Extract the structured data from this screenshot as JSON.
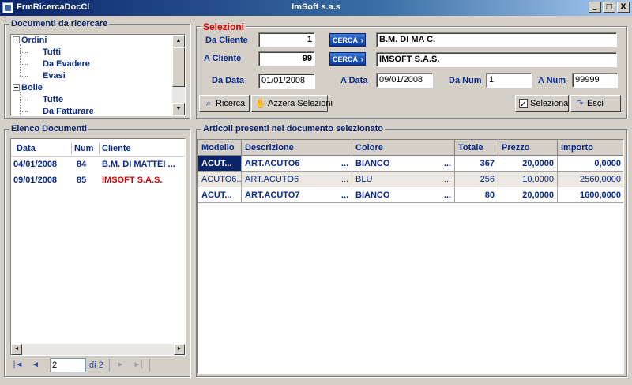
{
  "window": {
    "title": "FrmRicercaDocCl",
    "center_title": "ImSoft s.a.s",
    "min": "_",
    "max": "□",
    "close": "X"
  },
  "tree": {
    "title": "Documenti da ricercare",
    "items": [
      {
        "label": "Ordini",
        "level": 0
      },
      {
        "label": "Tutti",
        "level": 1
      },
      {
        "label": "Da Evadere",
        "level": 1
      },
      {
        "label": "Evasi",
        "level": 1
      },
      {
        "label": "Bolle",
        "level": 0
      },
      {
        "label": "Tutte",
        "level": 1
      },
      {
        "label": "Da Fatturare",
        "level": 1
      }
    ]
  },
  "selezioni": {
    "title": "Selezioni",
    "da_cliente_label": "Da Cliente",
    "da_cliente_value": "1",
    "da_cliente_name": "B.M. DI MA C.",
    "a_cliente_label": "A Cliente",
    "a_cliente_value": "99",
    "a_cliente_name": "IMSOFT S.A.S.",
    "cerca_label": "CERCA",
    "da_data_label": "Da Data",
    "da_data_value": "01/01/2008",
    "a_data_label": "A Data",
    "a_data_value": "09/01/2008",
    "da_num_label": "Da Num",
    "da_num_value": "1",
    "a_num_label": "A Num",
    "a_num_value": "99999"
  },
  "toolbar": {
    "ricerca": "Ricerca",
    "azzera": "Azzera Selezioni",
    "seleziona": "Seleziona",
    "esci": "Esci"
  },
  "elenco": {
    "title": "Elenco Documenti",
    "headers": [
      "Data",
      "Num",
      "Cliente"
    ],
    "rows": [
      {
        "data": "04/01/2008",
        "num": "84",
        "cliente": "B.M. DI MATTEI ...",
        "color": "#0a2a8a"
      },
      {
        "data": "09/01/2008",
        "num": "85",
        "cliente": "IMSOFT S.A.S.",
        "color": "#e00000"
      }
    ]
  },
  "navigator": {
    "position": "2",
    "of_label": "di 2"
  },
  "articoli": {
    "title": "Articoli presenti nel documento selezionato",
    "headers": [
      "Modello",
      "Descrizione",
      "Colore",
      "Totale",
      "Prezzo",
      "Importo"
    ],
    "rows": [
      {
        "modello": "ACUT...",
        "descrizione": "ART.ACUTO6",
        "colore": "BIANCO",
        "totale": "367",
        "prezzo": "20,0000",
        "importo": "0,0000",
        "style": "bold",
        "selected": true
      },
      {
        "modello": "ACUTO6...",
        "descrizione": "ART.ACUTO6",
        "colore": "BLU",
        "totale": "256",
        "prezzo": "10,0000",
        "importo": "2560,0000",
        "style": "norm",
        "selected": false
      },
      {
        "modello": "ACUT...",
        "descrizione": "ART.ACUTO7",
        "colore": "BIANCO",
        "totale": "80",
        "prezzo": "20,0000",
        "importo": "1600,0000",
        "style": "bold",
        "selected": false
      }
    ]
  },
  "ellipsis": "...",
  "colors": {
    "accent": "#0a2a8a",
    "red": "#e00000",
    "selected_bg": "#0a246a"
  }
}
